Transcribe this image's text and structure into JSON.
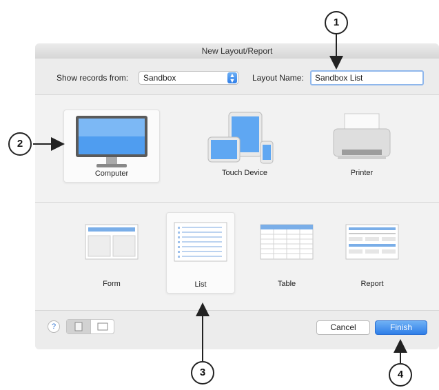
{
  "dialog": {
    "title": "New Layout/Report",
    "show_records_label": "Show records from:",
    "show_records_value": "Sandbox",
    "layout_name_label": "Layout Name:",
    "layout_name_value": "Sandbox List"
  },
  "devices": [
    {
      "label": "Computer",
      "selected": true
    },
    {
      "label": "Touch Device",
      "selected": false
    },
    {
      "label": "Printer",
      "selected": false
    }
  ],
  "layout_types": [
    {
      "label": "Form",
      "selected": false
    },
    {
      "label": "List",
      "selected": true
    },
    {
      "label": "Table",
      "selected": false
    },
    {
      "label": "Report",
      "selected": false
    }
  ],
  "footer": {
    "help_label": "?",
    "cancel_label": "Cancel",
    "finish_label": "Finish"
  },
  "callouts": [
    "1",
    "2",
    "3",
    "4"
  ],
  "colors": {
    "accent": "#2f7ee8",
    "screen": "#4f9df0"
  }
}
